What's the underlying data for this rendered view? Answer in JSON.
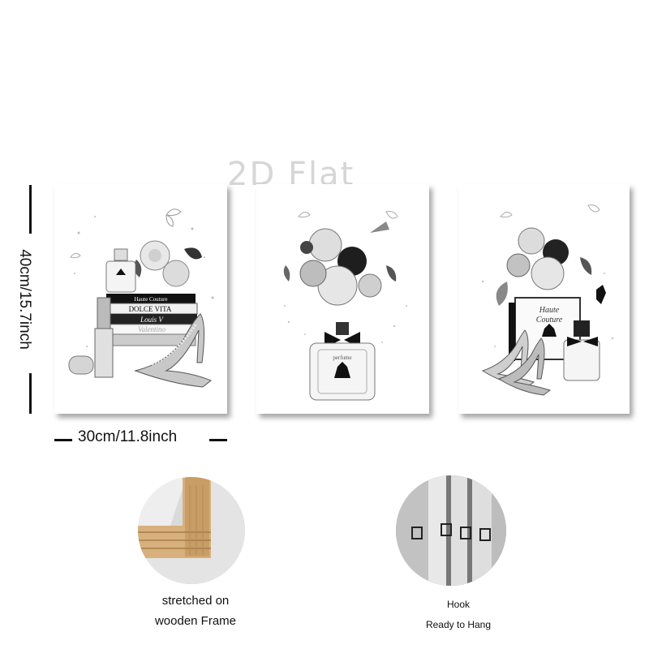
{
  "watermark": "2D Flat",
  "dimensions": {
    "height_label": "40cm/15.7inch",
    "width_label": "30cm/11.8inch"
  },
  "panels": [
    {
      "books": [
        "Haute Couture",
        "DOLCE VITA",
        "Louis V",
        "Valentino"
      ],
      "perfume_label": ""
    },
    {
      "perfume_label": "perfume"
    },
    {
      "box_text_line1": "Haute",
      "box_text_line2": "Couture"
    }
  ],
  "features": [
    {
      "caption_line1": "stretched on",
      "caption_line2": "wooden Frame"
    },
    {
      "caption_line1": "Hook",
      "caption_line2": "Ready to Hang"
    }
  ],
  "colors": {
    "accent": "#111111",
    "wood": "#d8b07c"
  }
}
